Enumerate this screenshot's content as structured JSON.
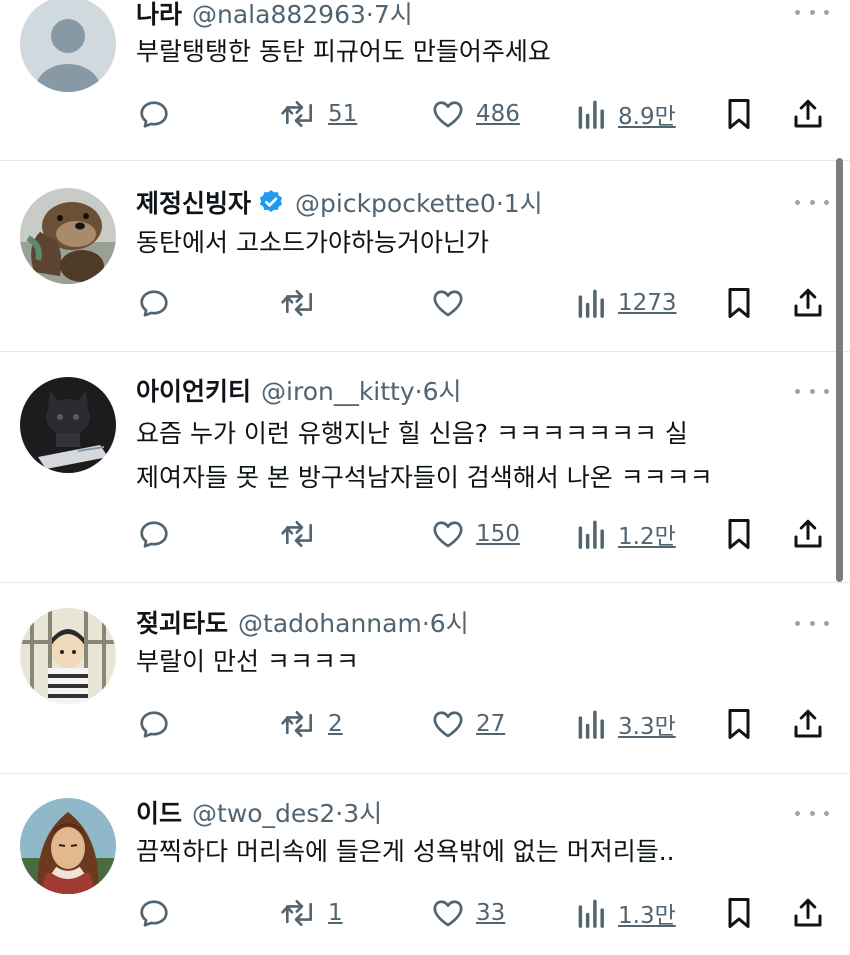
{
  "tweets": [
    {
      "name": "나라",
      "handle": "@nala882963",
      "time": "7시",
      "lines": [
        "부랄탱탱한 동탄 피규어도 만들어주세요"
      ],
      "reposts": "51",
      "likes": "486",
      "views": "8.9만",
      "verified": false,
      "avatar": "default-avatar"
    },
    {
      "name": "제정신빙자",
      "handle": "@pickpockette0",
      "time": "1시",
      "lines": [
        "동탄에서 고소드가야하능거아닌가"
      ],
      "reposts": "",
      "likes": "",
      "views": "1273",
      "verified": true,
      "avatar": "otter-avatar"
    },
    {
      "name": "아이언키티",
      "handle": "@iron__kitty",
      "time": "6시",
      "lines": [
        "요즘 누가 이런 유행지난 힐 신음? ㅋㅋㅋㅋㅋㅋㅋ  실",
        "제여자들 못 본 방구석남자들이 검색해서 나온 ㅋㅋㅋㅋ"
      ],
      "reposts": "",
      "likes": "150",
      "views": "1.2만",
      "verified": false,
      "avatar": "kitty-avatar"
    },
    {
      "name": "젖괴타도",
      "handle": "@tadohannam",
      "time": "6시",
      "lines": [
        "부랄이 만선 ㅋㅋㅋㅋ"
      ],
      "reposts": "2",
      "likes": "27",
      "views": "3.3만",
      "verified": false,
      "avatar": "prisoner-avatar"
    },
    {
      "name": "이드",
      "handle": "@two_des2",
      "time": "3시",
      "lines": [
        "끔찍하다 머리속에 들은게 성욕밖에 없는 머저리들.."
      ],
      "reposts": "1",
      "likes": "33",
      "views": "1.3만",
      "verified": false,
      "avatar": "anime-avatar"
    }
  ],
  "colors": {
    "text": "#0f1419",
    "secondary": "#536471",
    "verified": "#1d9bf0",
    "divider": "#e6e9eb"
  }
}
